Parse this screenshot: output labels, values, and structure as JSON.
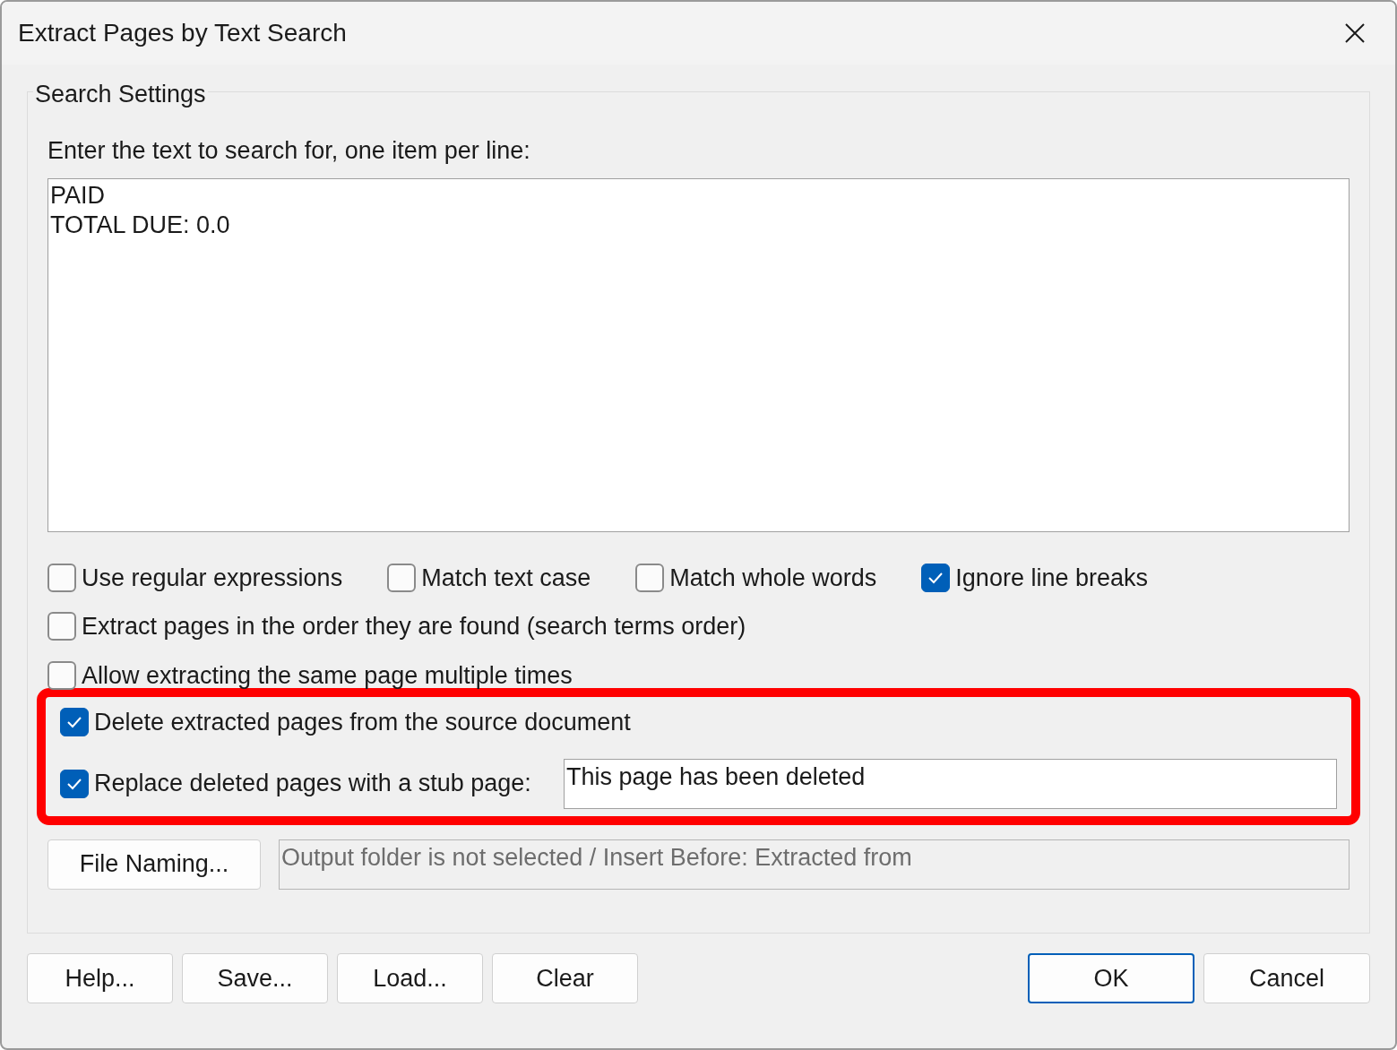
{
  "window": {
    "title": "Extract Pages by Text Search"
  },
  "group": {
    "title": "Search Settings"
  },
  "search_label": "Enter the text to search for, one item per line:",
  "search_text": {
    "value": "PAID\nTOTAL DUE: 0.0"
  },
  "option_rows": [
    {
      "options": [
        {
          "label": "Use regular expressions",
          "checked": false
        },
        {
          "label": "Match text case",
          "checked": false
        },
        {
          "label": "Match whole words",
          "checked": false
        },
        {
          "label": "Ignore line breaks",
          "checked": true
        }
      ]
    },
    {
      "options": [
        {
          "label": "Extract pages in the order they are found (search terms order)",
          "checked": false
        }
      ]
    },
    {
      "options": [
        {
          "label": "Allow extracting the same page multiple times",
          "checked": false
        }
      ]
    }
  ],
  "highlighted_options": [
    {
      "kind": "plain",
      "label": "Delete extracted pages from the source document",
      "checked": true
    },
    {
      "kind": "with_field",
      "label": "Replace deleted pages with a stub page:",
      "checked": true,
      "field": {
        "value": "This page has been deleted"
      }
    }
  ],
  "file_naming": {
    "button": "File Naming...",
    "output": {
      "value": "Output folder is not selected / Insert Before: Extracted from"
    }
  },
  "left_buttons": [
    {
      "label": "Help...",
      "default": false
    },
    {
      "label": "Save...",
      "default": false
    },
    {
      "label": "Load...",
      "default": false
    },
    {
      "label": "Clear",
      "default": false
    }
  ],
  "right_buttons": [
    {
      "label": "OK",
      "default": true
    },
    {
      "label": "Cancel",
      "default": false
    }
  ]
}
